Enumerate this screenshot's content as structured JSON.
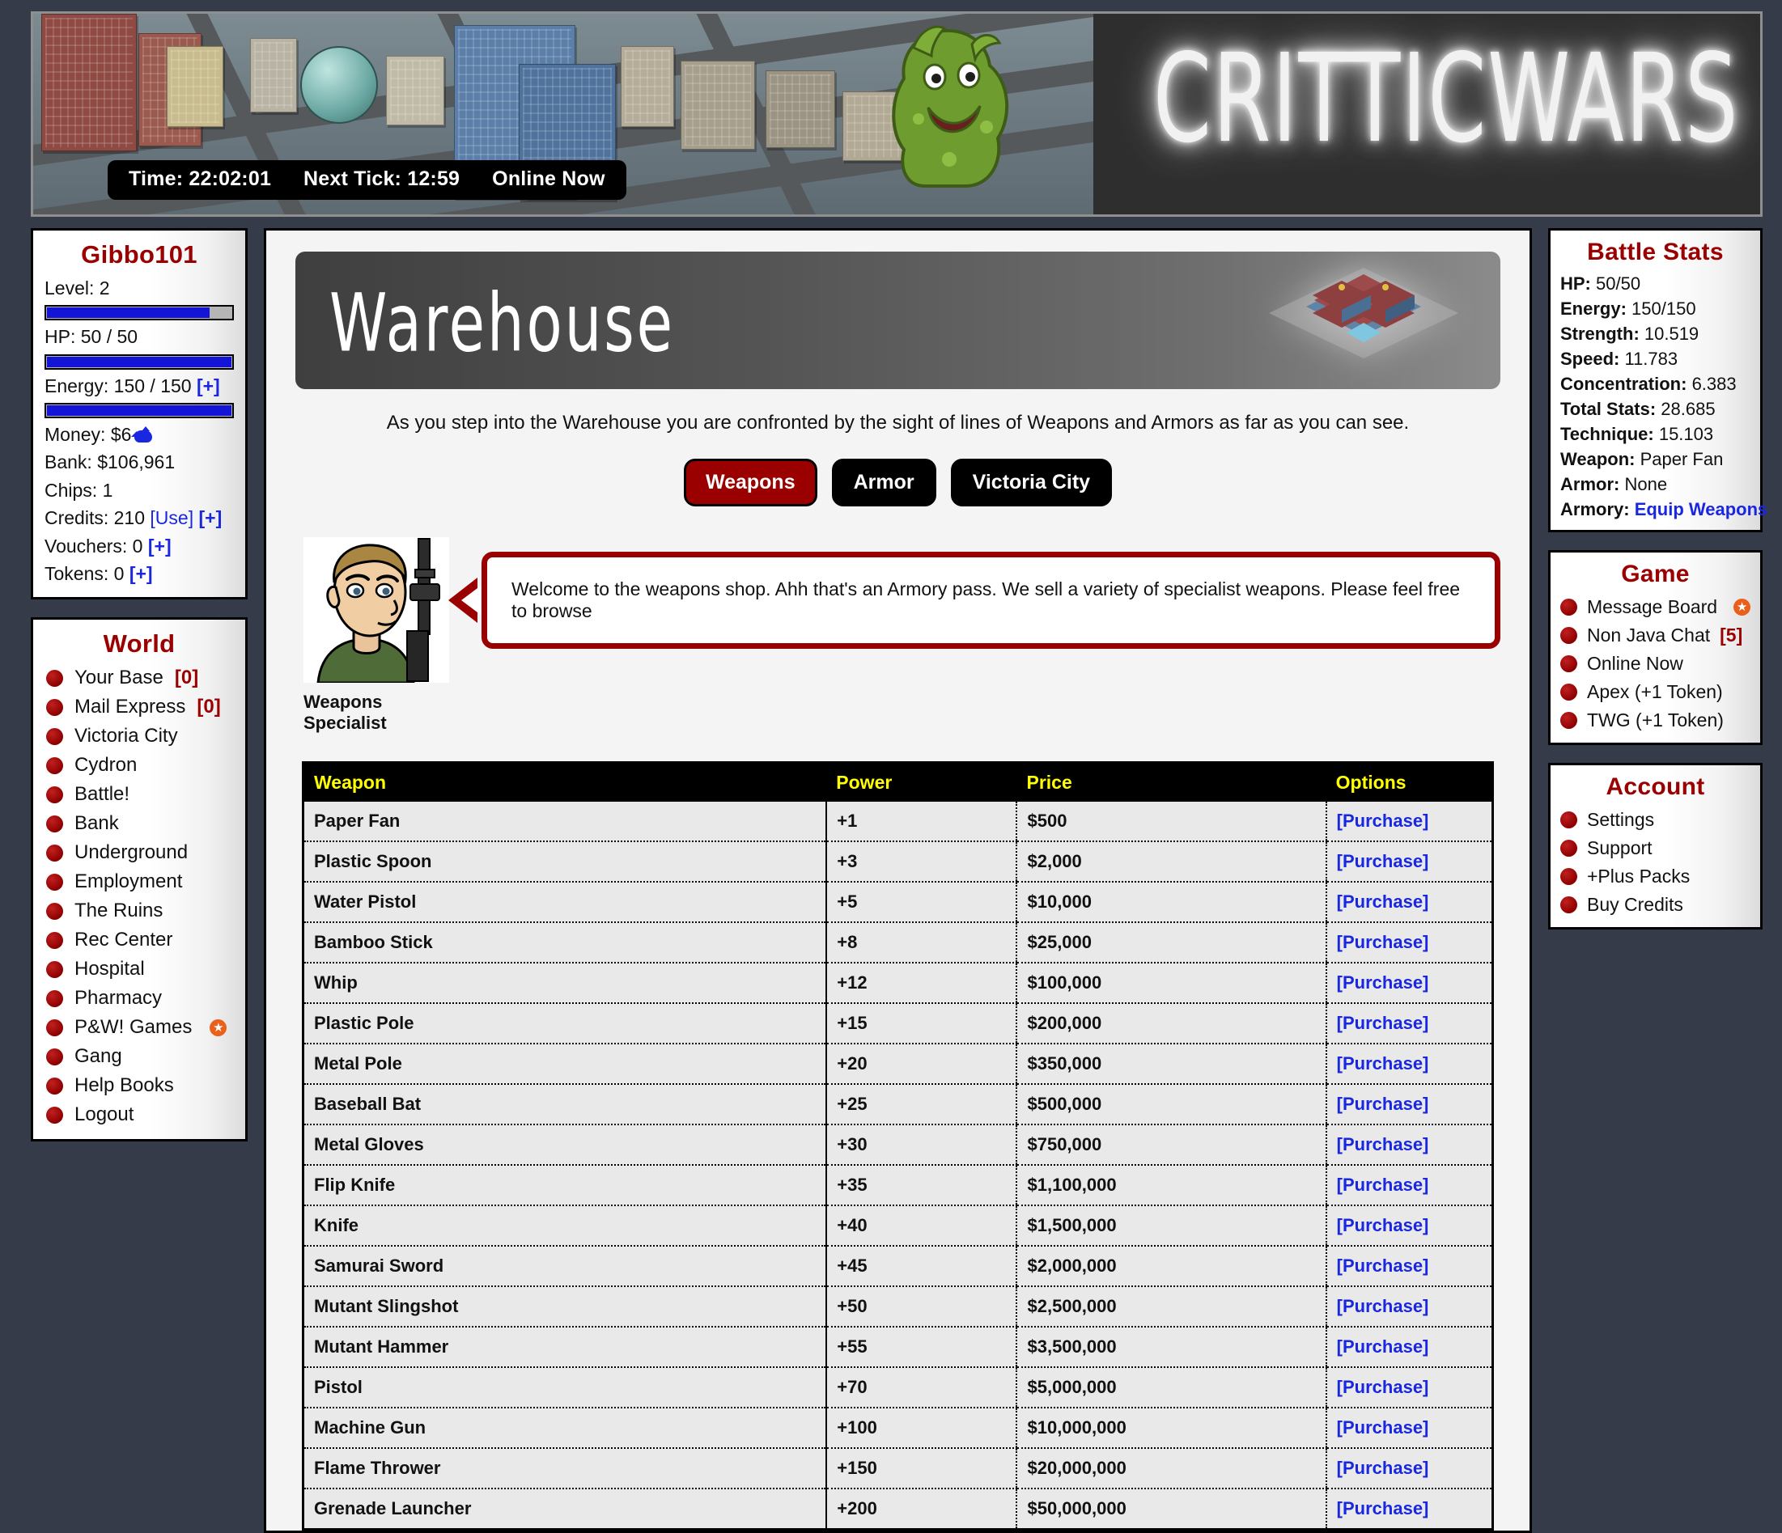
{
  "banner": {
    "logo_text": "CRITTICWARS",
    "timebar": {
      "time": "Time: 22:02:01",
      "next_tick": "Next Tick: 12:59",
      "online_now": "Online Now"
    }
  },
  "player": {
    "name": "Gibbo101",
    "level": "Level: 2",
    "level_pct": 88,
    "hp": "HP: 50 / 50",
    "hp_pct": 100,
    "energy_prefix": "Energy: 150 / 150 ",
    "energy_plus": "[+]",
    "energy_pct": 100,
    "money_prefix": "Money: $6",
    "bank": "Bank: $106,961",
    "chips": "Chips: 1",
    "credits_prefix": "Credits: 210 ",
    "credits_use": "[Use]",
    "credits_plus": " [+]",
    "vouchers_prefix": "Vouchers: 0 ",
    "vouchers_plus": "[+]",
    "tokens_prefix": "Tokens: 0 ",
    "tokens_plus": "[+]"
  },
  "world": {
    "title": "World",
    "items": [
      {
        "label": "Your Base ",
        "badge": "[0]",
        "star": false
      },
      {
        "label": "Mail Express ",
        "badge": "[0]",
        "star": false
      },
      {
        "label": "Victoria City",
        "badge": "",
        "star": false
      },
      {
        "label": "Cydron",
        "badge": "",
        "star": false
      },
      {
        "label": "Battle!",
        "badge": "",
        "star": false
      },
      {
        "label": "Bank",
        "badge": "",
        "star": false
      },
      {
        "label": "Underground",
        "badge": "",
        "star": false
      },
      {
        "label": "Employment",
        "badge": "",
        "star": false
      },
      {
        "label": "The Ruins",
        "badge": "",
        "star": false
      },
      {
        "label": "Rec Center",
        "badge": "",
        "star": false
      },
      {
        "label": "Hospital",
        "badge": "",
        "star": false
      },
      {
        "label": "Pharmacy",
        "badge": "",
        "star": false
      },
      {
        "label": "P&W! Games",
        "badge": "",
        "star": true
      },
      {
        "label": "Gang",
        "badge": "",
        "star": false
      },
      {
        "label": "Help Books",
        "badge": "",
        "star": false
      },
      {
        "label": "Logout",
        "badge": "",
        "star": false
      }
    ]
  },
  "battle_stats": {
    "title": "Battle Stats",
    "rows": [
      {
        "k": "HP:",
        "v": " 50/50",
        "link": false
      },
      {
        "k": "Energy:",
        "v": " 150/150",
        "link": false
      },
      {
        "k": "Strength:",
        "v": " 10.519",
        "link": false
      },
      {
        "k": "Speed:",
        "v": " 11.783",
        "link": false
      },
      {
        "k": "Concentration:",
        "v": " 6.383",
        "link": false
      },
      {
        "k": "Total Stats:",
        "v": " 28.685",
        "link": false
      },
      {
        "k": "Technique:",
        "v": " 15.103",
        "link": false
      },
      {
        "k": "Weapon:",
        "v": " Paper Fan",
        "link": false
      },
      {
        "k": "Armor:",
        "v": " None",
        "link": false
      },
      {
        "k": "Armory:",
        "v": " Equip Weapons",
        "link": true
      }
    ]
  },
  "game": {
    "title": "Game",
    "items": [
      {
        "label": "Message Board",
        "badge": "",
        "star": true
      },
      {
        "label": "Non Java Chat ",
        "badge": "[5]",
        "star": false
      },
      {
        "label": "Online Now",
        "badge": "",
        "star": false
      },
      {
        "label": "Apex (+1 Token)",
        "badge": "",
        "star": false
      },
      {
        "label": "TWG (+1 Token)",
        "badge": "",
        "star": false
      }
    ]
  },
  "account": {
    "title": "Account",
    "items": [
      {
        "label": "Settings",
        "badge": "",
        "star": false
      },
      {
        "label": "Support",
        "badge": "",
        "star": false
      },
      {
        "label": "+Plus Packs",
        "badge": "",
        "star": false
      },
      {
        "label": "Buy Credits",
        "badge": "",
        "star": false
      }
    ]
  },
  "main": {
    "header_title": "Warehouse",
    "intro": "As you step into the Warehouse you are confronted by the sight of lines of Weapons and Armors as far as you can see.",
    "tabs": [
      {
        "label": "Weapons",
        "active": true
      },
      {
        "label": "Armor",
        "active": false
      },
      {
        "label": "Victoria City",
        "active": false
      }
    ],
    "npc": {
      "name": "Weapons Specialist",
      "speech": "Welcome to the weapons shop. Ahh that's an Armory pass. We sell a variety of specialist weapons. Please feel free to browse"
    },
    "table": {
      "headers": [
        "Weapon",
        "Power",
        "Price",
        "Options"
      ],
      "purchase_label": "[Purchase]",
      "rows": [
        {
          "weapon": "Paper Fan",
          "power": "+1",
          "price": "$500"
        },
        {
          "weapon": "Plastic Spoon",
          "power": "+3",
          "price": "$2,000"
        },
        {
          "weapon": "Water Pistol",
          "power": "+5",
          "price": "$10,000"
        },
        {
          "weapon": "Bamboo Stick",
          "power": "+8",
          "price": "$25,000"
        },
        {
          "weapon": "Whip",
          "power": "+12",
          "price": "$100,000"
        },
        {
          "weapon": "Plastic Pole",
          "power": "+15",
          "price": "$200,000"
        },
        {
          "weapon": "Metal Pole",
          "power": "+20",
          "price": "$350,000"
        },
        {
          "weapon": "Baseball Bat",
          "power": "+25",
          "price": "$500,000"
        },
        {
          "weapon": "Metal Gloves",
          "power": "+30",
          "price": "$750,000"
        },
        {
          "weapon": "Flip Knife",
          "power": "+35",
          "price": "$1,100,000"
        },
        {
          "weapon": "Knife",
          "power": "+40",
          "price": "$1,500,000"
        },
        {
          "weapon": "Samurai Sword",
          "power": "+45",
          "price": "$2,000,000"
        },
        {
          "weapon": "Mutant Slingshot",
          "power": "+50",
          "price": "$2,500,000"
        },
        {
          "weapon": "Mutant Hammer",
          "power": "+55",
          "price": "$3,500,000"
        },
        {
          "weapon": "Pistol",
          "power": "+70",
          "price": "$5,000,000"
        },
        {
          "weapon": "Machine Gun",
          "power": "+100",
          "price": "$10,000,000"
        },
        {
          "weapon": "Flame Thrower",
          "power": "+150",
          "price": "$20,000,000"
        },
        {
          "weapon": "Grenade Launcher",
          "power": "+200",
          "price": "$50,000,000"
        }
      ]
    }
  },
  "colors": {
    "accent_red": "#9b0000",
    "link_blue": "#1a27e0",
    "power_green": "#0a7a18",
    "header_yellow": "#ffff00",
    "page_bg": "#353b48"
  }
}
